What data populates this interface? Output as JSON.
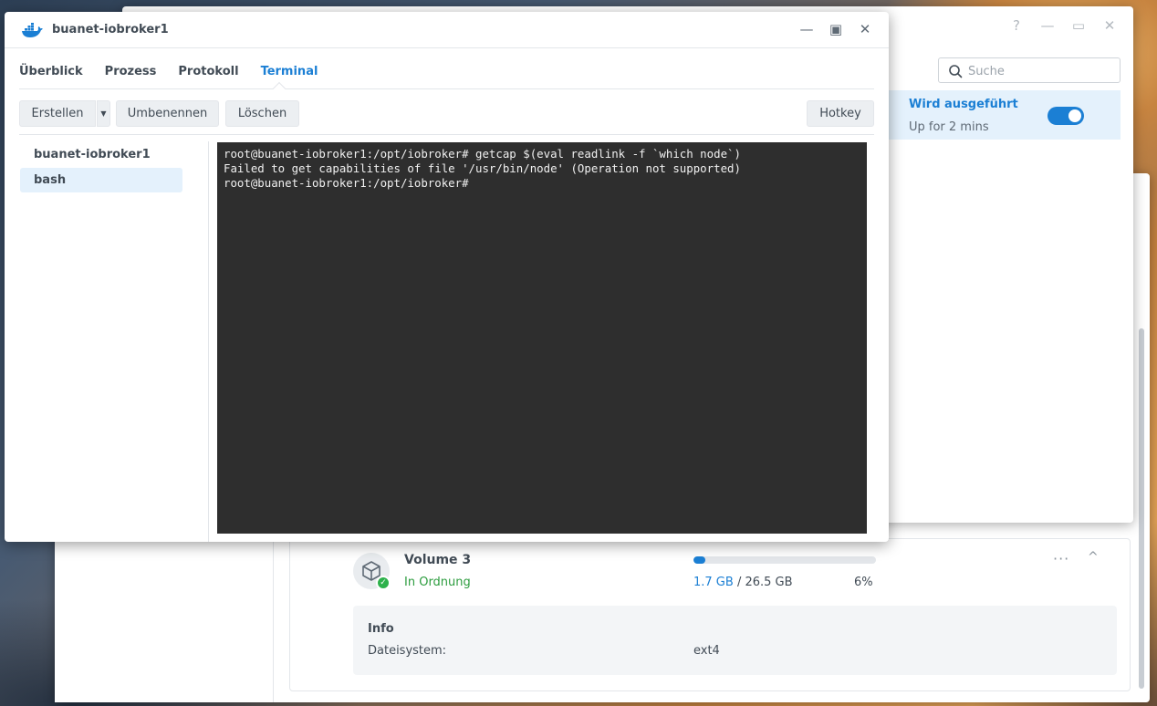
{
  "storage_window": {
    "volume": {
      "name": "Volume 3",
      "status": "In Ordnung",
      "used": "1.7 GB",
      "separator": " / ",
      "total": "26.5 GB",
      "percent": "6%",
      "usage_fraction": 0.064,
      "more_label": "···",
      "collapse_label": "^"
    },
    "info": {
      "title": "Info",
      "filesystem_label": "Dateisystem:",
      "filesystem_value": "ext4"
    }
  },
  "container_manager": {
    "controls": {
      "help": "?",
      "minimize": "—",
      "maximize": "▭",
      "close": "✕"
    },
    "search": {
      "placeholder": "Suche",
      "value": ""
    },
    "container_row": {
      "status": "Wird ausgeführt",
      "uptime": "Up for 2 mins",
      "toggle_on": true
    }
  },
  "container_window": {
    "title": "buanet-iobroker1",
    "controls": {
      "minimize": "—",
      "maximize": "▣",
      "close": "✕"
    },
    "tabs": [
      {
        "label": "Überblick",
        "active": false
      },
      {
        "label": "Prozess",
        "active": false
      },
      {
        "label": "Protokoll",
        "active": false
      },
      {
        "label": "Terminal",
        "active": true
      }
    ],
    "toolbar": {
      "create": "Erstellen",
      "create_dropdown": "▼",
      "rename": "Umbenennen",
      "delete": "Löschen",
      "hotkey": "Hotkey"
    },
    "sessions": [
      {
        "label": "buanet-iobroker1",
        "selected": false
      },
      {
        "label": "bash",
        "selected": true
      }
    ],
    "terminal_lines": "root@buanet-iobroker1:/opt/iobroker# getcap $(eval readlink -f `which node`)\nFailed to get capabilities of file '/usr/bin/node' (Operation not supported)\nroot@buanet-iobroker1:/opt/iobroker#"
  },
  "colors": {
    "accent": "#1b7fd4",
    "ok": "#2c9c3e",
    "terminal_bg": "#2e2e2e",
    "selected_bg": "#e4f1fc"
  }
}
